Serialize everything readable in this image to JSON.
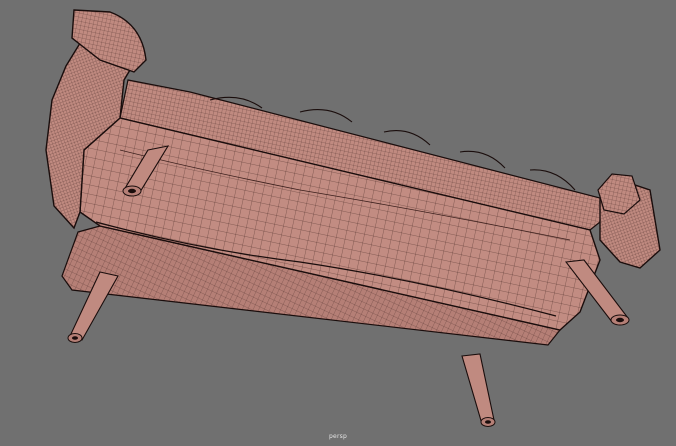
{
  "viewport": {
    "camera_label": "persp",
    "colors": {
      "background": "#707070",
      "mesh_fill": "#c08a80",
      "mesh_fill_dark": "#a87068",
      "wire": "#2a1614",
      "outline": "#1a0d0c"
    }
  }
}
